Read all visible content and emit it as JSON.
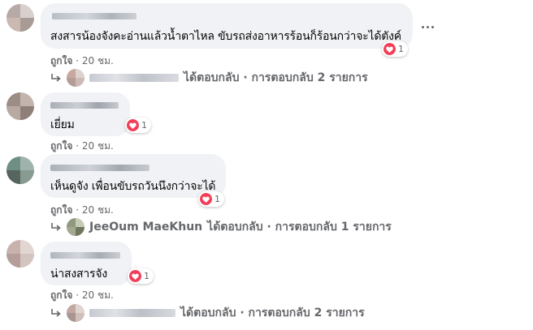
{
  "colors": {
    "bubble": "#f0f2f5",
    "meta_text": "#65676b",
    "heart": "#f33e58"
  },
  "comments": [
    {
      "text": "สงสารน้องจังคะอ่านแล้วน้ำตาไหล ขับรถส่งอาหารร้อนก็ร้อนกว่าจะได้ตังค์",
      "reactions": "1",
      "like_label": "ถูกใจ",
      "separator": " · ",
      "time": "20 ชม.",
      "reply_text": "ได้ตอบกลับ · การตอบกลับ 2 รายการ"
    },
    {
      "text": "เยี่ยม",
      "reactions": "1",
      "like_label": "ถูกใจ",
      "separator": " · ",
      "time": "20 ชม."
    },
    {
      "text": "เห็นดูจัง เพื่อนขับรถวันนึงกว่าจะได้",
      "reactions": "1",
      "like_label": "ถูกใจ",
      "separator": " · ",
      "time": "20 ชม.",
      "reply_name": "JeeOum MaeKhun",
      "reply_text": "ได้ตอบกลับ · การตอบกลับ 1 รายการ"
    },
    {
      "text": "น่าสงสารจัง",
      "reactions": "1",
      "like_label": "ถูกใจ",
      "separator": " · ",
      "time": "20 ชม.",
      "reply_text": "ได้ตอบกลับ · การตอบกลับ 2 รายการ"
    }
  ]
}
